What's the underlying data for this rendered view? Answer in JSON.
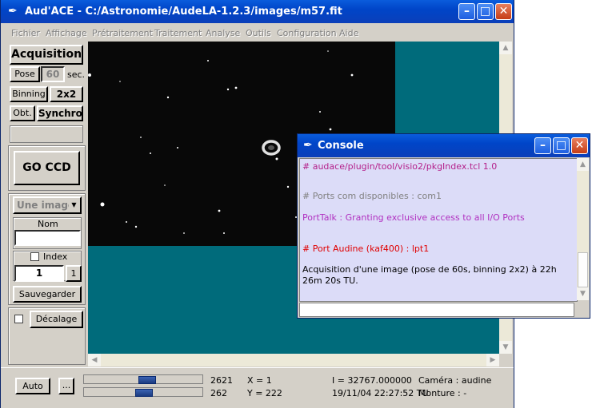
{
  "main_window": {
    "title": "Aud'ACE - C:/Astronomie/AudeLA-1.2.3/images/m57.fit",
    "menu": [
      "Fichier",
      "Affichage",
      "Prétraitement",
      "Traitement",
      "Analyse",
      "Outils",
      "Configuration",
      "Aide"
    ]
  },
  "panel": {
    "acquisition_label": "Acquisition",
    "pose_label": "Pose",
    "pose_value": "60",
    "sec_label": "sec.",
    "binning_label": "Binning",
    "binning_value": "2x2",
    "obt_label": "Obt.",
    "synchro_label": "Synchro",
    "go_ccd_label": "GO CCD",
    "mode_select": "Une image",
    "nom_label": "Nom",
    "nom_value": "",
    "index_label": "Index",
    "index_value": "1",
    "index_button": "1",
    "sauvegarder_label": "Sauvegarder",
    "decalage_label": "Décalage"
  },
  "status": {
    "auto_label": "Auto",
    "dots_label": "...",
    "slider1_value": "2621",
    "slider2_value": "262",
    "x_text": "X = 1",
    "y_text": "Y = 222",
    "intensity_text": "I = 32767.000000",
    "datetime_text": "19/11/04 22:27:52 TU",
    "camera_text": "Caméra : audine",
    "monture_text": "Monture : -"
  },
  "console": {
    "title": "Console",
    "lines": [
      {
        "text": "# audace/plugin/tool/visio2/pkgIndex.tcl 1.0",
        "color": "#b4208a"
      },
      {
        "text": "# Ports com disponibles : com1",
        "color": "#808080"
      },
      {
        "text": "PortTalk : Granting exclusive access to all I/O Ports",
        "color": "#b030c0"
      },
      {
        "text": "# Port Audine (kaf400) : lpt1",
        "color": "#e00000"
      },
      {
        "text": "Acquisition d'une image (pose de 60s, binning 2x2) à 22h",
        "color": "#000000"
      },
      {
        "text": "26m 20s TU.",
        "color": "#000000"
      }
    ],
    "input_value": ""
  }
}
